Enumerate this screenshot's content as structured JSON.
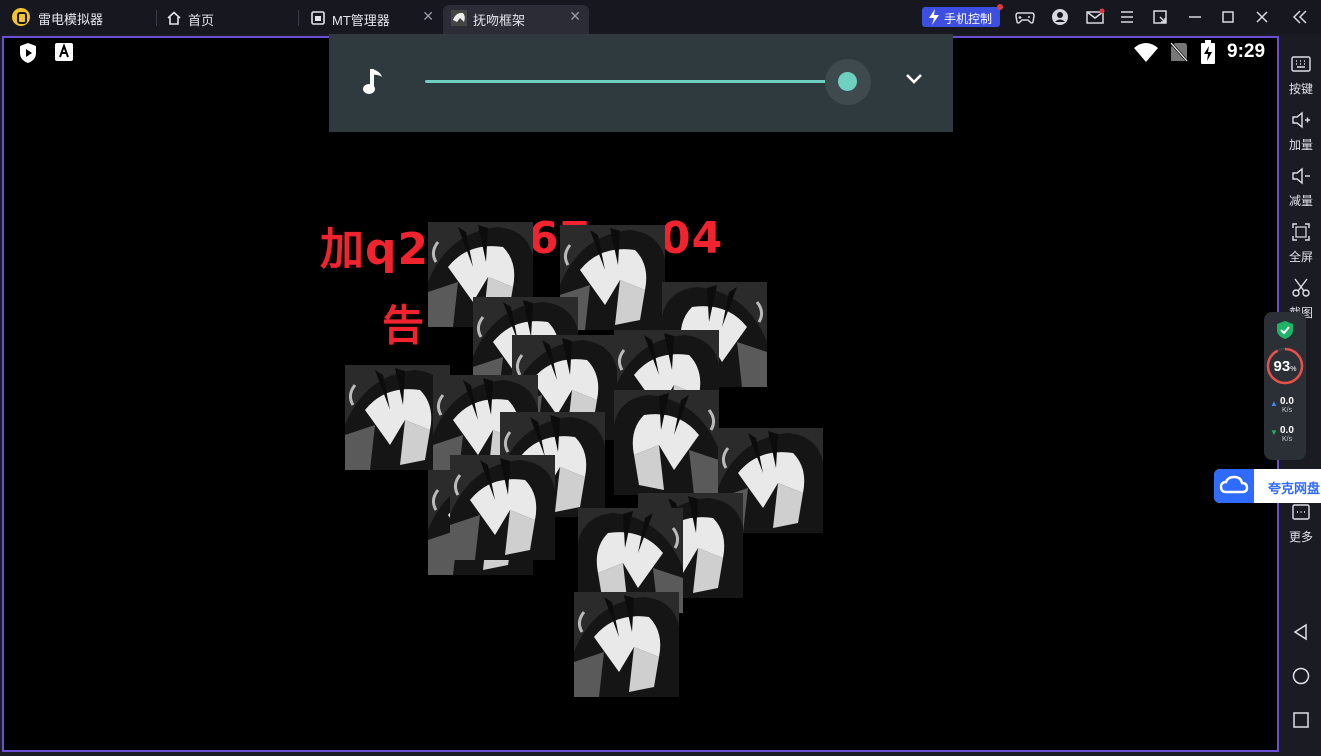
{
  "app": {
    "title": "雷电模拟器"
  },
  "tabs": [
    {
      "label": "首页",
      "icon": "home-icon"
    },
    {
      "label": "MT管理器",
      "icon": "app-window-icon"
    },
    {
      "label": "抚吻框架",
      "icon": "app-thumbnail-icon",
      "active": true
    }
  ],
  "toolbar": {
    "phone_control_label": "手机控制",
    "icons": [
      "gamepad-icon",
      "user-icon",
      "mail-icon",
      "menu-icon",
      "popout-icon",
      "minimize-icon",
      "maximize-icon",
      "close-icon",
      "collapse-sidebar-icon"
    ]
  },
  "statusbar": {
    "time": "9:29",
    "icons": [
      "shield-play-icon",
      "font-a-icon",
      "wifi-icon",
      "no-sim-icon",
      "battery-charging-icon"
    ]
  },
  "media_panel": {
    "icon": "music-note-icon",
    "volume_fraction": 0.98,
    "expand_icon": "chevron-down-icon"
  },
  "screen_content": {
    "red_line_1": "加q2",
    "red_line_1_tail": "67",
    "red_line_1_end": "04",
    "red_line_2": "告"
  },
  "sidebar": {
    "items": [
      {
        "label": "按键",
        "icon": "keyboard-icon"
      },
      {
        "label": "加量",
        "icon": "volume-up-icon"
      },
      {
        "label": "减量",
        "icon": "volume-down-icon"
      },
      {
        "label": "全屏",
        "icon": "fullscreen-icon"
      },
      {
        "label": "截图",
        "icon": "scissors-icon"
      },
      {
        "label": "更多",
        "icon": "more-icon"
      }
    ],
    "nav": [
      "back-icon",
      "home-circle-icon",
      "recents-icon"
    ]
  },
  "perf_widget": {
    "value": "93",
    "unit": "%",
    "upload": "0.0",
    "download": "0.0",
    "speed_unit": "K/s"
  },
  "quark": {
    "label": "夸克网盘"
  },
  "colors": {
    "accent": "#6a4fd4",
    "phone_control_bg": "#3d4fe0",
    "slider": "#6fcfc1",
    "red_text": "#f0232f",
    "quark_blue": "#2f6bff"
  }
}
